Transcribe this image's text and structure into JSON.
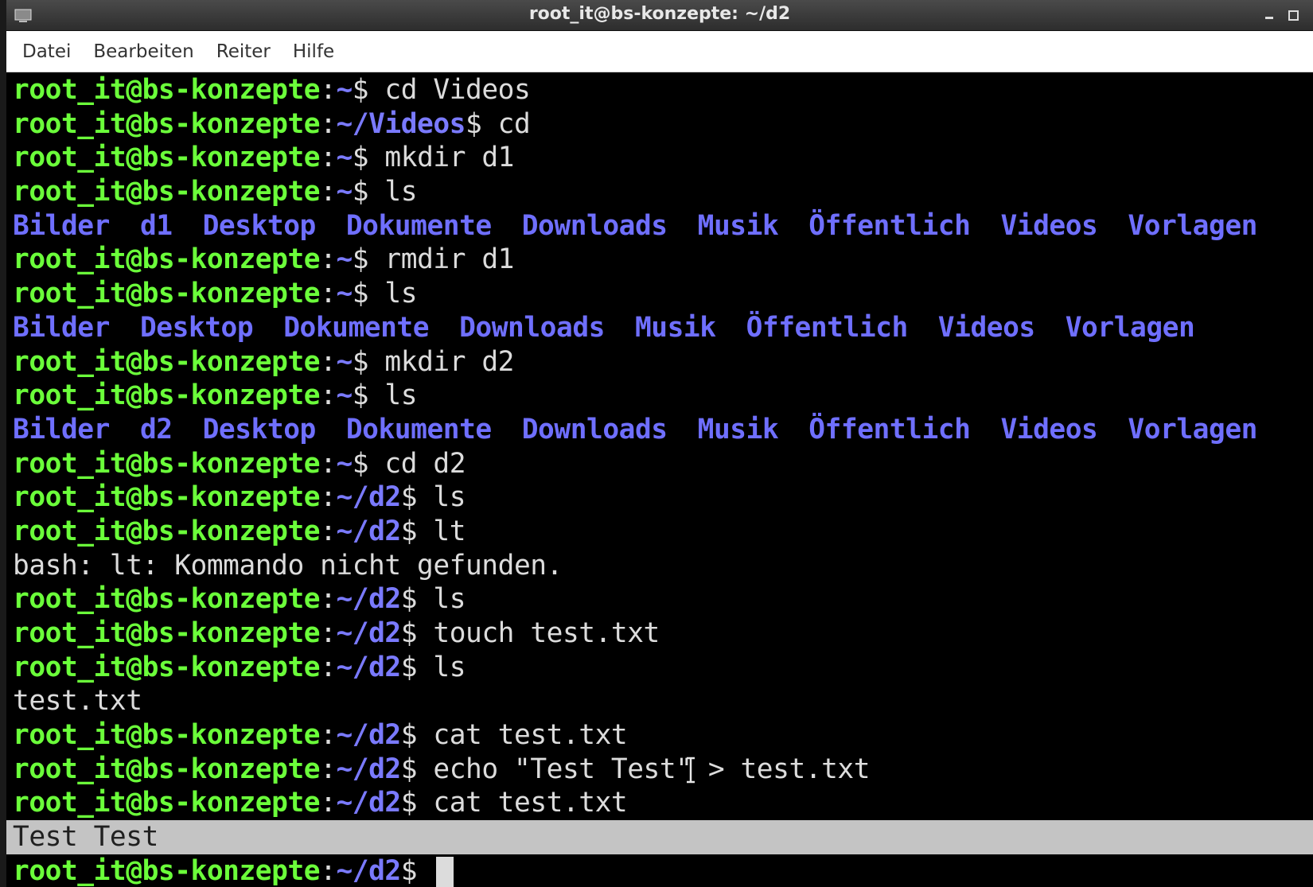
{
  "window": {
    "title": "root_it@bs-konzepte: ~/d2"
  },
  "menu": [
    "Datei",
    "Bearbeiten",
    "Reiter",
    "Hilfe"
  ],
  "prompt": {
    "user_host": "root_it@bs-konzepte",
    "colon": ":",
    "suffix": "$ "
  },
  "lines": [
    {
      "path": "~",
      "cmd": "cd Videos"
    },
    {
      "path": "~/Videos",
      "cmd": "cd"
    },
    {
      "path": "~",
      "cmd": "mkdir d1"
    },
    {
      "path": "~",
      "cmd": "ls"
    },
    {
      "dirs": [
        "Bilder",
        "d1",
        "Desktop",
        "Dokumente",
        "Downloads",
        "Musik",
        "Öffentlich",
        "Videos",
        "Vorlagen"
      ]
    },
    {
      "path": "~",
      "cmd": "rmdir d1"
    },
    {
      "path": "~",
      "cmd": "ls"
    },
    {
      "dirs": [
        "Bilder",
        "Desktop",
        "Dokumente",
        "Downloads",
        "Musik",
        "Öffentlich",
        "Videos",
        "Vorlagen"
      ]
    },
    {
      "path": "~",
      "cmd": "mkdir d2"
    },
    {
      "path": "~",
      "cmd": "ls"
    },
    {
      "dirs": [
        "Bilder",
        "d2",
        "Desktop",
        "Dokumente",
        "Downloads",
        "Musik",
        "Öffentlich",
        "Videos",
        "Vorlagen"
      ]
    },
    {
      "path": "~",
      "cmd": "cd d2"
    },
    {
      "path": "~/d2",
      "cmd": "ls"
    },
    {
      "path": "~/d2",
      "cmd": "lt"
    },
    {
      "out": "bash: lt: Kommando nicht gefunden."
    },
    {
      "path": "~/d2",
      "cmd": "ls"
    },
    {
      "path": "~/d2",
      "cmd": "touch test.txt"
    },
    {
      "path": "~/d2",
      "cmd": "ls"
    },
    {
      "out": "test.txt"
    },
    {
      "path": "~/d2",
      "cmd": "cat test.txt"
    },
    {
      "path": "~/d2",
      "cmd": "echo \"Test Test\" > test.txt",
      "ibeam": true
    },
    {
      "path": "~/d2",
      "cmd": "cat test.txt"
    },
    {
      "out": "Test Test",
      "highlight": true
    },
    {
      "path": "~/d2",
      "cmd": "",
      "cursor": true
    }
  ]
}
